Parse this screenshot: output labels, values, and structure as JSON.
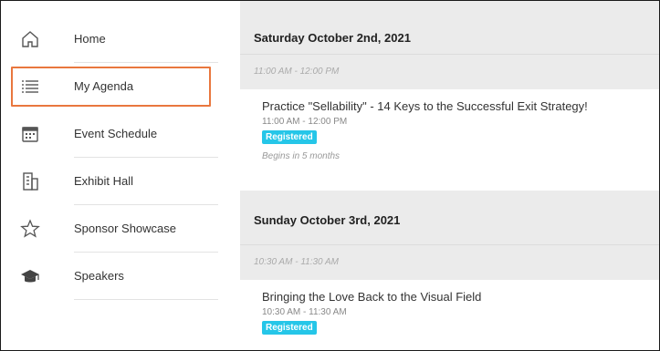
{
  "nav": {
    "items": [
      {
        "label": "Home",
        "icon": "home-icon"
      },
      {
        "label": "My Agenda",
        "icon": "list-icon",
        "selected": true
      },
      {
        "label": "Event Schedule",
        "icon": "calendar-icon"
      },
      {
        "label": "Exhibit Hall",
        "icon": "building-icon"
      },
      {
        "label": "Sponsor Showcase",
        "icon": "star-icon"
      },
      {
        "label": "Speakers",
        "icon": "graduation-cap-icon"
      }
    ]
  },
  "agenda": {
    "days": [
      {
        "date": "Saturday October 2nd, 2021",
        "slot": "11:00 AM - 12:00 PM",
        "session": {
          "title": "Practice \"Sellability\" - 14 Keys to the Successful Exit Strategy!",
          "time": "11:00 AM - 12:00 PM",
          "badge": "Registered",
          "note": "Begins in 5 months"
        }
      },
      {
        "date": "Sunday October 3rd, 2021",
        "slot": "10:30 AM - 11:30 AM",
        "session": {
          "title": "Bringing the Love Back to the Visual Field",
          "time": "10:30 AM - 11:30 AM",
          "badge": "Registered"
        }
      }
    ]
  },
  "colors": {
    "highlight": "#e9773e",
    "badge": "#25c6e8",
    "main_bg": "#ebebeb"
  }
}
